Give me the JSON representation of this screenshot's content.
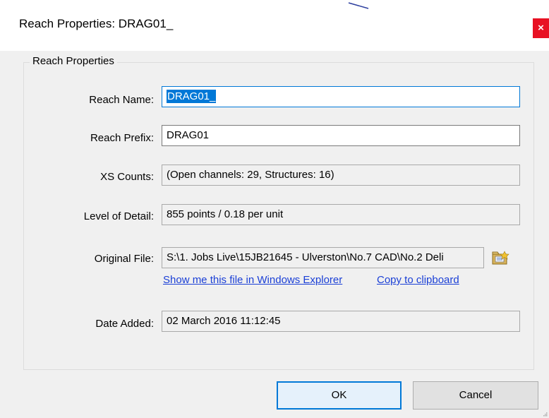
{
  "window": {
    "title": "Reach Properties: DRAG01_",
    "close_glyph": "×"
  },
  "group": {
    "legend": "Reach Properties"
  },
  "fields": {
    "reach_name": {
      "label": "Reach Name:",
      "value": "DRAG01_"
    },
    "reach_prefix": {
      "label": "Reach Prefix:",
      "value": "DRAG01"
    },
    "xs_counts": {
      "label": "XS Counts:",
      "value": "(Open channels: 29, Structures: 16)"
    },
    "level_of_detail": {
      "label": "Level of Detail:",
      "value": "855 points / 0.18 per unit"
    },
    "original_file": {
      "label": "Original File:",
      "value": "S:\\1. Jobs Live\\15JB21645 - Ulverston\\No.7 CAD\\No.2 Deli"
    },
    "date_added": {
      "label": "Date Added:",
      "value": "02 March 2016 11:12:45"
    }
  },
  "links": {
    "show_in_explorer": "Show me this file in Windows Explorer",
    "copy_to_clipboard": "Copy to clipboard"
  },
  "buttons": {
    "ok": "OK",
    "cancel": "Cancel"
  },
  "icons": {
    "browse": "open-folder-icon",
    "close": "close-icon",
    "resize": "resize-grip-icon"
  },
  "colors": {
    "accent": "#0078d7",
    "close_red": "#e81123",
    "link": "#1a3fd6",
    "dialog_bg": "#f0f0f0"
  }
}
